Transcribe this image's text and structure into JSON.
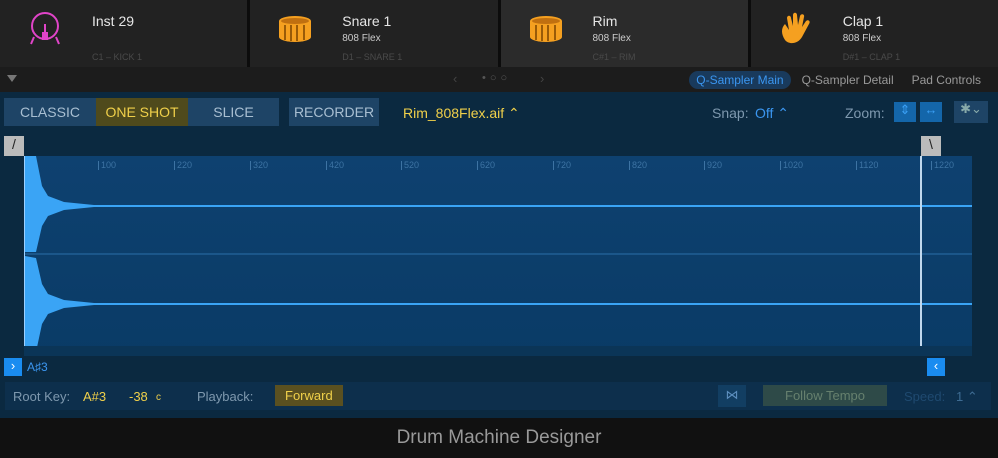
{
  "pads": [
    {
      "name": "Inst 29",
      "subtitle": "",
      "note": "C1 – KICK 1",
      "icon": "kick-drum-icon",
      "color": "#e044c8"
    },
    {
      "name": "Snare 1",
      "subtitle": "808 Flex",
      "note": "D1 – SNARE 1",
      "icon": "snare-drum-icon",
      "color": "#f5a020"
    },
    {
      "name": "Rim",
      "subtitle": "808 Flex",
      "note": "C#1 – RIM",
      "icon": "snare-drum-icon",
      "color": "#f5a020"
    },
    {
      "name": "Clap 1",
      "subtitle": "808 Flex",
      "note": "D#1 – CLAP 1",
      "icon": "hand-clap-icon",
      "color": "#f5a020"
    }
  ],
  "nav": {
    "tabs": [
      "Q-Sampler Main",
      "Q-Sampler Detail",
      "Pad Controls"
    ],
    "active_tab": 0,
    "page": "•○○"
  },
  "toolbar": {
    "modes": [
      "CLASSIC",
      "ONE SHOT",
      "SLICE"
    ],
    "active_mode": 1,
    "recorder": "RECORDER",
    "file": "Rim_808Flex.aif ⌃",
    "snap_label": "Snap:",
    "snap_value": "Off ⌃",
    "zoom_label": "Zoom:"
  },
  "ruler": [
    "100",
    "220",
    "320",
    "420",
    "520",
    "620",
    "720",
    "820",
    "920",
    "1020",
    "1120",
    "1220"
  ],
  "key_marker": "A♯3",
  "bottom": {
    "root_key_label": "Root Key:",
    "root_key": "A#3",
    "tune": "-38",
    "tune_unit": "c",
    "playback_label": "Playback:",
    "playback": "Forward",
    "follow_tempo": "Follow Tempo",
    "speed_label": "Speed:",
    "speed": "1 ⌃"
  },
  "footer": "Drum Machine Designer",
  "colors": {
    "accent": "#3b96f0",
    "yellow": "#f0d04a",
    "wave": "#3aa4f5"
  }
}
